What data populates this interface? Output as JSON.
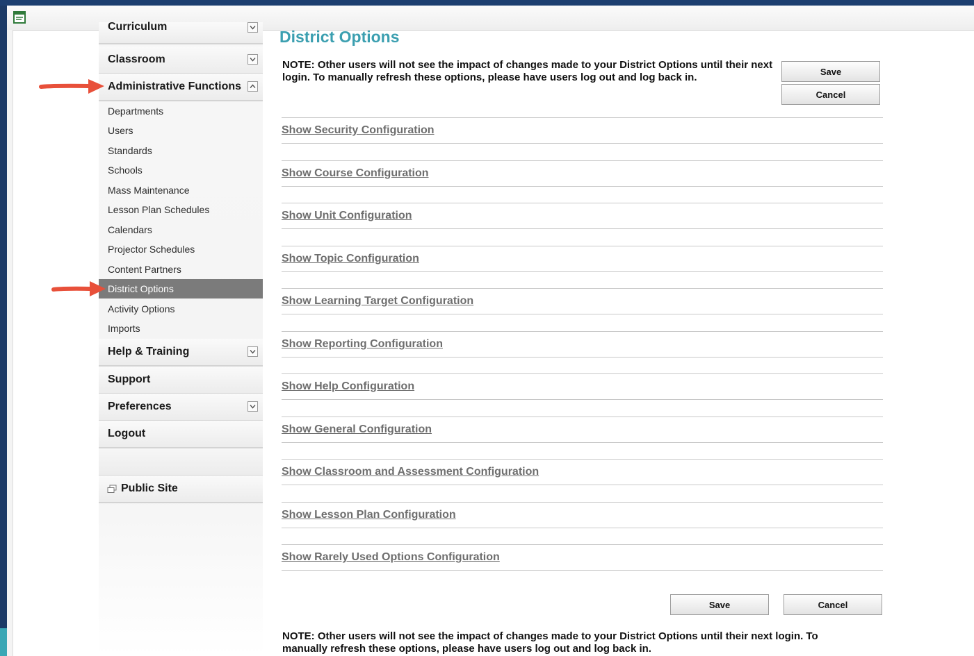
{
  "sidebar": {
    "curriculum": "Curriculum",
    "classroom": "Classroom",
    "admin": "Administrative Functions",
    "admin_items": [
      "Departments",
      "Users",
      "Standards",
      "Schools",
      "Mass Maintenance",
      "Lesson Plan Schedules",
      "Calendars",
      "Projector Schedules",
      "Content Partners",
      "District Options",
      "Activity Options",
      "Imports"
    ],
    "help": "Help & Training",
    "support": "Support",
    "preferences": "Preferences",
    "logout": "Logout",
    "public_site": "Public Site"
  },
  "main": {
    "title": "District Options",
    "note_top": "NOTE: Other users will not see the impact of changes made to your District Options until their next login. To manually refresh these options, please have users log out and log back in.",
    "note_bottom": "NOTE: Other users will not see the impact of changes made to your District Options until their next login. To manually refresh these options, please have users log out and log back in.",
    "save": "Save",
    "cancel": "Cancel",
    "sections": [
      "Show Security Configuration",
      "Show Course Configuration",
      "Show Unit Configuration",
      "Show Topic Configuration",
      "Show Learning Target Configuration",
      "Show Reporting Configuration",
      "Show Help Configuration",
      "Show General Configuration",
      "Show Classroom and Assessment Configuration",
      "Show Lesson Plan Configuration",
      "Show Rarely Used Options Configuration"
    ]
  },
  "colors": {
    "title": "#3b9fb0",
    "active_item": "#7b7b7b",
    "arrow": "#e8503a"
  },
  "active_item": "District Options"
}
